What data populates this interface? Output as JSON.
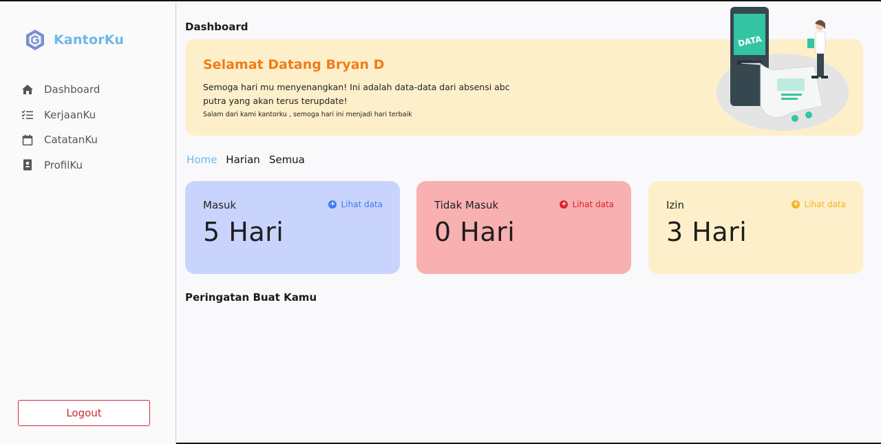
{
  "brand": {
    "name": "KantorKu"
  },
  "sidebar": {
    "items": [
      {
        "label": "Dashboard",
        "icon": "home-icon"
      },
      {
        "label": "KerjaanKu",
        "icon": "checklist-icon"
      },
      {
        "label": "CatatanKu",
        "icon": "calendar-icon"
      },
      {
        "label": "ProfilKu",
        "icon": "profile-book-icon"
      }
    ],
    "logout_label": "Logout"
  },
  "main": {
    "page_title": "Dashboard",
    "banner": {
      "title": "Selamat Datang Bryan D",
      "text": "Semoga hari mu menyenangkan! Ini adalah data-data dari absensi abc putra yang akan terus terupdate!",
      "small": "Salam dari kami kantorku , semoga hari ini menjadi hari terbaik",
      "illustration_label": "DATA"
    },
    "tabs": [
      {
        "label": "Home",
        "active": true
      },
      {
        "label": "Harian",
        "active": false
      },
      {
        "label": "Semua",
        "active": false
      }
    ],
    "cards": [
      {
        "title": "Masuk",
        "value": "5 Hari",
        "link": "Lihat data",
        "bg": "#c9d4fc",
        "accent": "#3a7bf0"
      },
      {
        "title": "Tidak Masuk",
        "value": "0 Hari",
        "link": "Lihat data",
        "bg": "#f8b0b0",
        "accent": "#e0202a"
      },
      {
        "title": "Izin",
        "value": "3 Hari",
        "link": "Lihat data",
        "bg": "#fdefc9",
        "accent": "#f2b424"
      }
    ],
    "warning_title": "Peringatan Buat Kamu"
  }
}
